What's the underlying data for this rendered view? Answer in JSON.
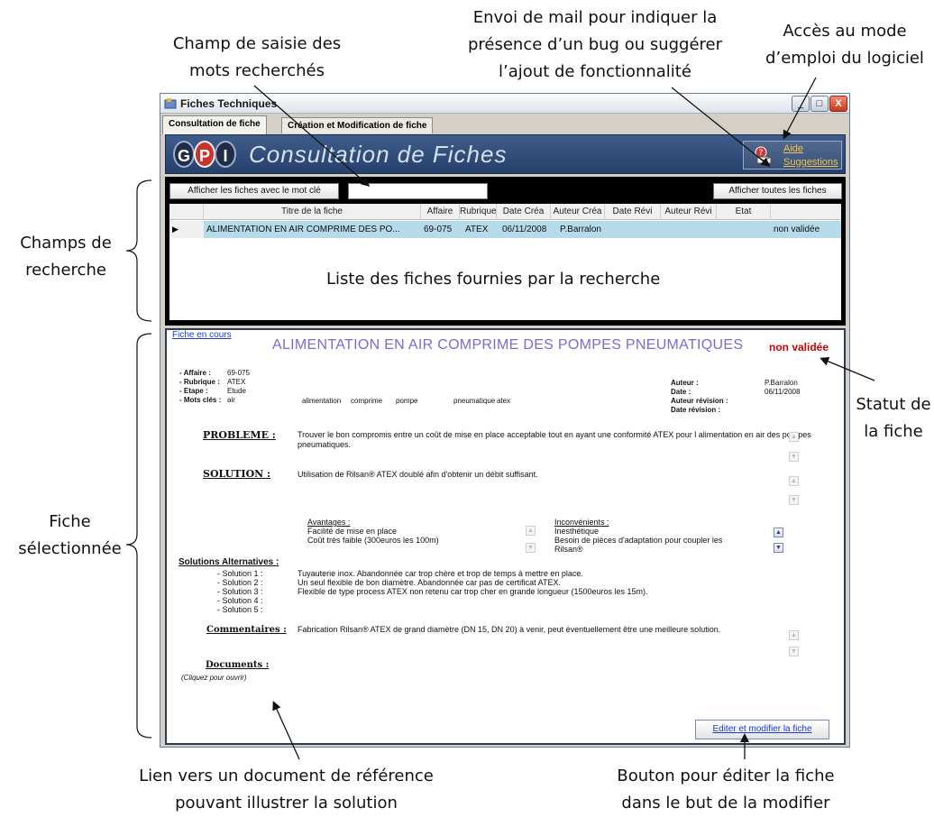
{
  "annotations": {
    "search_input_note": [
      "Champ de saisie des",
      "mots recherchés"
    ],
    "mail_note": [
      "Envoi de mail pour indiquer la",
      "présence d’un bug ou suggérer",
      "l’ajout de fonctionnalité"
    ],
    "help_note": [
      "Accès au mode",
      "d’emploi du logiciel"
    ],
    "search_fields_note": [
      "Champs de",
      "recherche"
    ],
    "status_note": [
      "Statut de",
      "la fiche"
    ],
    "selected_fiche_note": [
      "Fiche",
      "sélectionnée"
    ],
    "document_link_note": [
      "Lien vers un document de référence",
      "pouvant illustrer la solution"
    ],
    "edit_button_note": [
      "Bouton pour éditer la fiche",
      "dans le but de la modifier"
    ]
  },
  "window": {
    "title": "Fiches Techniques",
    "controls": {
      "minimize": "_",
      "maximize": "□",
      "close": "X"
    }
  },
  "tabs": [
    {
      "label": "Consultation de fiche",
      "active": true
    },
    {
      "label": "Création et Modification de fiche",
      "active": false
    }
  ],
  "header": {
    "logo_letters": [
      "G",
      "P",
      "I"
    ],
    "title": "Consultation de Fiches",
    "help_link": "Aide",
    "suggestions_link": "Suggestions"
  },
  "search": {
    "search_button": "Afficher les fiches avec le mot clé",
    "input_value": "",
    "show_all_button": "Afficher toutes les fiches"
  },
  "grid": {
    "columns": [
      "Titre de la fiche",
      "Affaire",
      "Rubrique",
      "Date Créa",
      "Auteur Créa",
      "Date Révi",
      "Auteur Révi",
      "Etat"
    ],
    "rows": [
      {
        "marker": "▶",
        "cells": [
          "ALIMENTATION EN AIR COMPRIME DES PO...",
          "69-075",
          "ATEX",
          "06/11/2008",
          "P.Barralon",
          "",
          "",
          "non validée"
        ]
      }
    ],
    "caption": "Liste des fiches fournies par la recherche"
  },
  "fiche": {
    "current_link": "Fiche en cours",
    "title": "ALIMENTATION EN AIR COMPRIME DES POMPES PNEUMATIQUES",
    "status": "non validée",
    "meta_left": [
      {
        "label": "- Affaire :",
        "value": "69-075"
      },
      {
        "label": "- Rubrique :",
        "value": "ATEX"
      },
      {
        "label": "- Etape :",
        "value": "Etude"
      },
      {
        "label": "- Mots clés :",
        "value": "air"
      }
    ],
    "keywords": [
      "alimentation",
      "comprime",
      "pompe",
      "pneumatique",
      "atex"
    ],
    "meta_right": [
      {
        "label": "Auteur :",
        "value": "P.Barralon"
      },
      {
        "label": "Date :",
        "value": "06/11/2008"
      },
      {
        "label": "Auteur révision :",
        "value": ""
      },
      {
        "label": "Date révision :",
        "value": ""
      }
    ],
    "probleme_label": "PROBLEME :",
    "probleme_text": "Trouver le bon compromis entre un coût de mise en place acceptable tout en ayant une conformité ATEX pour l alimentation en air des pompes pneumatiques.",
    "solution_label": "SOLUTION :",
    "solution_text": "Utilisation de Rilsan® ATEX doublé afin d'obtenir un débit suffisant.",
    "avantages_label": "Avantages :",
    "avantages": [
      "Facilité de mise en place",
      "Coût très faible (300euros les 100m)"
    ],
    "inconvenients_label": "Inconvénients :",
    "inconvenients": [
      "Inesthétique",
      "Besoin de pièces d'adaptation pour coupler les",
      "Rilsan®"
    ],
    "alternatives_label": "Solutions Alternatives :",
    "alternatives": [
      {
        "label": "- Solution 1 :",
        "text": "Tuyauterie inox. Abandonnée car trop chère et trop de temps à mettre en place."
      },
      {
        "label": "- Solution 2 :",
        "text": "Un seul flexible de bon diamètre. Abandonnée car pas de certificat ATEX."
      },
      {
        "label": "- Solution 3 :",
        "text": "Flexible de type process ATEX non retenu car trop cher en grande longueur (1500euros les 15m)."
      },
      {
        "label": "- Solution 4 :",
        "text": ""
      },
      {
        "label": "- Solution 5 :",
        "text": ""
      }
    ],
    "commentaires_label": "Commentaires :",
    "commentaires_text": "Fabrication Rilsan® ATEX de grand diamètre (DN 15, DN 20) à venir, peut éventuellement être une meilleure solution.",
    "documents_label": "Documents :",
    "documents_hint": "(Cliquez pour ouvrir)",
    "edit_button": "Editer et modifier la fiche"
  },
  "colors": {
    "header_blue": "#2f4b7a",
    "selected_row": "#b5dbea",
    "status_red": "#d00000",
    "title_purple": "#7a6ad8",
    "link_blue": "#1a3fd0"
  }
}
